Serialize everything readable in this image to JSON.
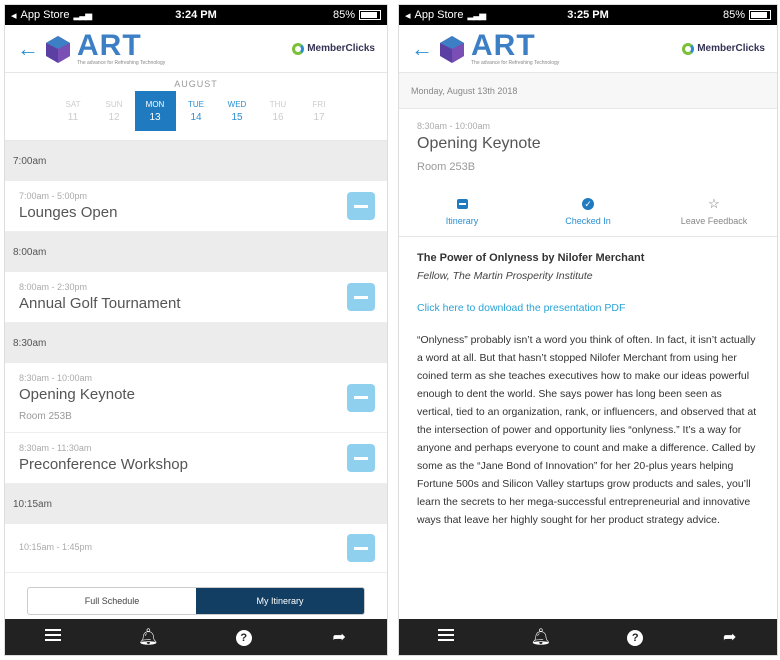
{
  "left": {
    "status": {
      "carrier": "App Store",
      "time": "3:24 PM",
      "battery": "85%"
    },
    "header": {
      "title": "ART",
      "tagline": "The advance for Refreshing Technology",
      "partner": "MemberClicks"
    },
    "datepicker": {
      "month": "AUGUST",
      "days": [
        {
          "dow": "SAT",
          "num": "11"
        },
        {
          "dow": "SUN",
          "num": "12"
        },
        {
          "dow": "MON",
          "num": "13"
        },
        {
          "dow": "TUE",
          "num": "14"
        },
        {
          "dow": "WED",
          "num": "15"
        },
        {
          "dow": "THU",
          "num": "16"
        },
        {
          "dow": "FRI",
          "num": "17"
        }
      ]
    },
    "schedule": [
      {
        "type": "header",
        "label": "7:00am"
      },
      {
        "type": "event",
        "time": "7:00am - 5:00pm",
        "title": "Lounges Open",
        "room": ""
      },
      {
        "type": "header",
        "label": "8:00am"
      },
      {
        "type": "event",
        "time": "8:00am - 2:30pm",
        "title": "Annual Golf Tournament",
        "room": ""
      },
      {
        "type": "header",
        "label": "8:30am"
      },
      {
        "type": "event",
        "time": "8:30am - 10:00am",
        "title": "Opening Keynote",
        "room": "Room 253B"
      },
      {
        "type": "event",
        "time": "8:30am - 11:30am",
        "title": "Preconference Workshop",
        "room": ""
      },
      {
        "type": "header",
        "label": "10:15am"
      },
      {
        "type": "event",
        "time": "10:15am - 1:45pm",
        "title": "",
        "room": ""
      }
    ],
    "segment": {
      "full": "Full Schedule",
      "mine": "My Itinerary"
    }
  },
  "right": {
    "status": {
      "carrier": "App Store",
      "time": "3:25 PM",
      "battery": "85%"
    },
    "header": {
      "title": "ART",
      "tagline": "The advance for Refreshing Technology",
      "partner": "MemberClicks"
    },
    "date": "Monday, August 13th 2018",
    "event": {
      "time": "8:30am - 10:00am",
      "title": "Opening Keynote",
      "room": "Room 253B"
    },
    "actions": {
      "itinerary": "Itinerary",
      "checked": "Checked In",
      "feedback": "Leave Feedback"
    },
    "speaker": "The Power of Onlyness by Nilofer Merchant",
    "role": "Fellow, The Martin Prosperity Institute",
    "link": "Click here to download the presentation PDF",
    "body": "“Onlyness” probably isn’t a word you think of often. In fact, it isn’t actually a word at all. But that hasn’t stopped Nilofer Merchant from using her coined term as she teaches executives how to make our ideas powerful enough to dent the world. She says power has long been seen as vertical, tied to an organization, rank, or influencers, and observed that at the intersection of power and opportunity lies “onlyness.” It’s a way for anyone and perhaps everyone to count and make a difference. Called by some as the “Jane Bond of Innovation” for her 20-plus years helping Fortune 500s and Silicon Valley startups grow products and sales, you’ll learn the secrets to her mega-successful entrepreneurial and innovative ways that leave her highly sought for her product strategy advice."
  }
}
